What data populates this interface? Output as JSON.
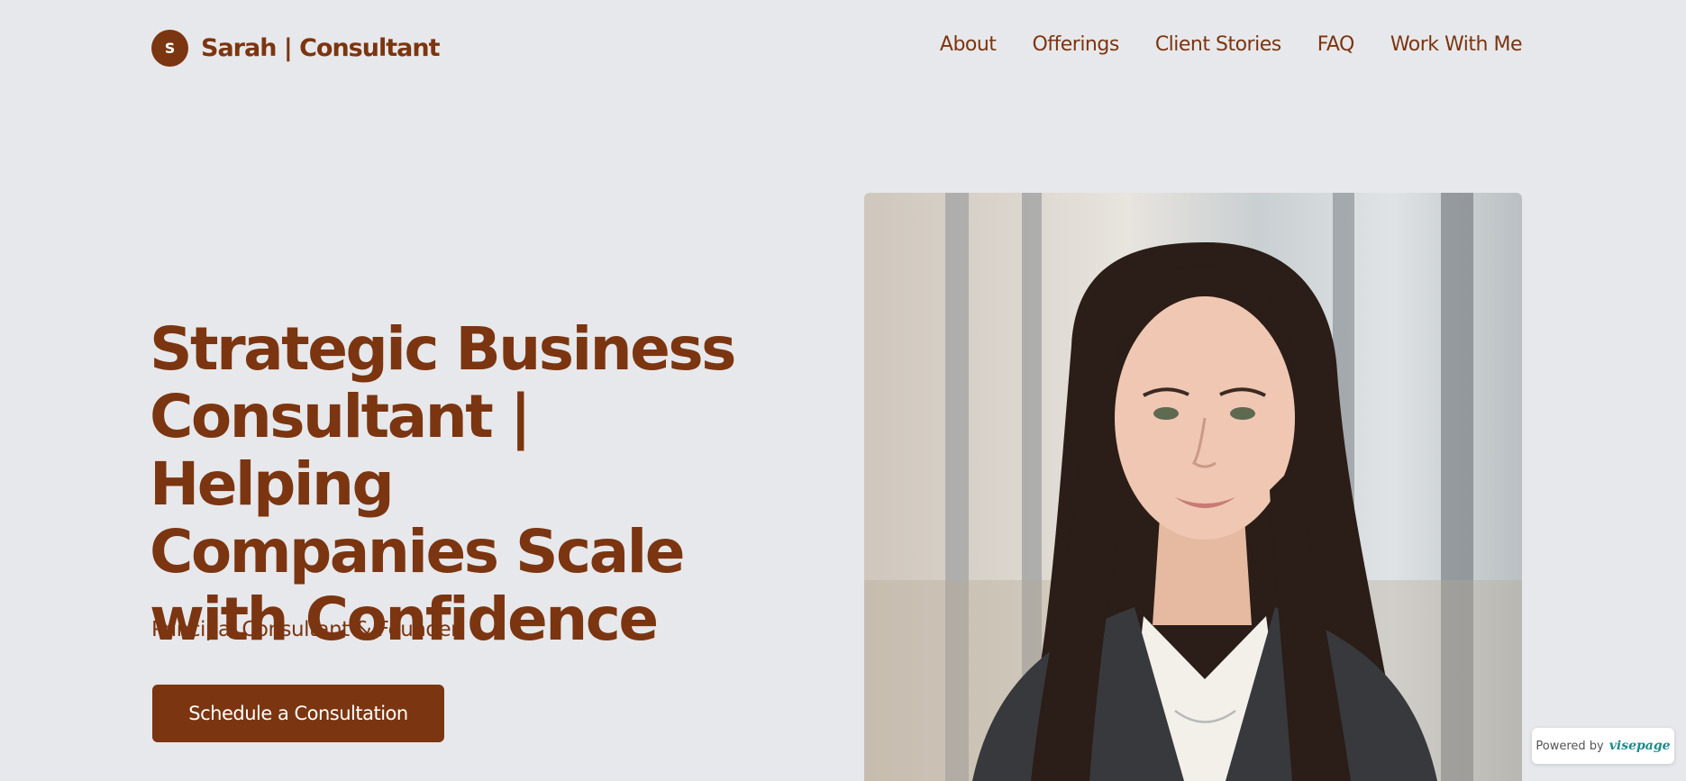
{
  "header": {
    "logo_letter": "S",
    "brand": "Sarah | Consultant",
    "nav": [
      {
        "label": "About"
      },
      {
        "label": "Offerings"
      },
      {
        "label": "Client Stories"
      },
      {
        "label": "FAQ"
      },
      {
        "label": "Work With Me"
      }
    ]
  },
  "hero": {
    "title_lines": [
      "Strategic Business",
      "Consultant | Helping",
      "Companies Scale",
      "with Confidence"
    ],
    "subtitle": "Principal Consultant & Founder",
    "cta_label": "Schedule a Consultation",
    "portrait_alt": "Portrait photo"
  },
  "badge": {
    "text": "Powered by",
    "brand": "visepage"
  },
  "colors": {
    "background": "#e7e8eb",
    "accent": "#7b3510",
    "badge_brand": "#1c8c8c"
  }
}
